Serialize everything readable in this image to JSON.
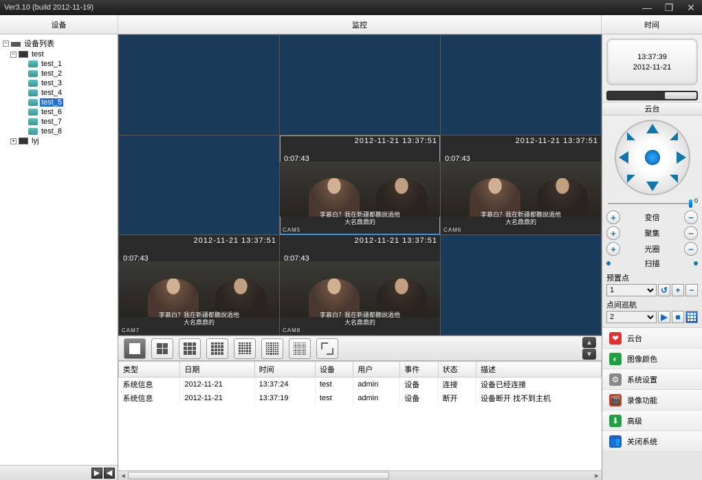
{
  "titlebar": {
    "title": "Ver3.10 (build 2012-11-19)"
  },
  "header": {
    "device": "设备",
    "monitor": "监控",
    "time": "时间"
  },
  "tree": {
    "root": "设备列表",
    "devices": [
      {
        "name": "test",
        "cams": [
          "test_1",
          "test_2",
          "test_3",
          "test_4",
          "test_5",
          "test_6",
          "test_7",
          "test_8"
        ],
        "selected": "test_5"
      },
      {
        "name": "lyj",
        "cams": []
      }
    ]
  },
  "clock": {
    "time": "13:37:39",
    "date": "2012-11-21"
  },
  "ptz": {
    "title": "云台",
    "speed": "0",
    "rows": [
      {
        "label": "变倍"
      },
      {
        "label": "聚集"
      },
      {
        "label": "光圈"
      },
      {
        "label": "扫描",
        "scan": true
      }
    ],
    "preset_label": "预置点",
    "preset_value": "1",
    "cruise_label": "点间巡航",
    "cruise_value": "2"
  },
  "video": {
    "osd_date": "2012-11-21 13:37:51",
    "timer": "0:07:43",
    "subtitle_l1": "李慕白？我在新疆都聽說過他",
    "subtitle_l2": "大名鼎鼎的",
    "cams": [
      "CAM5",
      "CAM6",
      "CAM7",
      "CAM8"
    ]
  },
  "log": {
    "headers": [
      "类型",
      "日期",
      "时间",
      "设备",
      "用户",
      "事件",
      "状态",
      "描述"
    ],
    "rows": [
      [
        "系统信息",
        "2012-11-21",
        "13:37:24",
        "test",
        "admin",
        "设备",
        "连接",
        "设备已经连接"
      ],
      [
        "系统信息",
        "2012-11-21",
        "13:37:19",
        "test",
        "admin",
        "设备",
        "断开",
        "设备断开 找不到主机"
      ]
    ]
  },
  "rmenu": [
    {
      "label": "云台",
      "color": "#e03030",
      "glyph": "❤"
    },
    {
      "label": "图像颜色",
      "color": "#20a040",
      "glyph": "◐"
    },
    {
      "label": "系统设置",
      "color": "#888",
      "glyph": "⚙"
    },
    {
      "label": "录像功能",
      "color": "#c04020",
      "glyph": "🎬"
    },
    {
      "label": "高级",
      "color": "#20a040",
      "glyph": "⬇"
    },
    {
      "label": "关闭系统",
      "color": "#2060c0",
      "glyph": "👥"
    }
  ]
}
